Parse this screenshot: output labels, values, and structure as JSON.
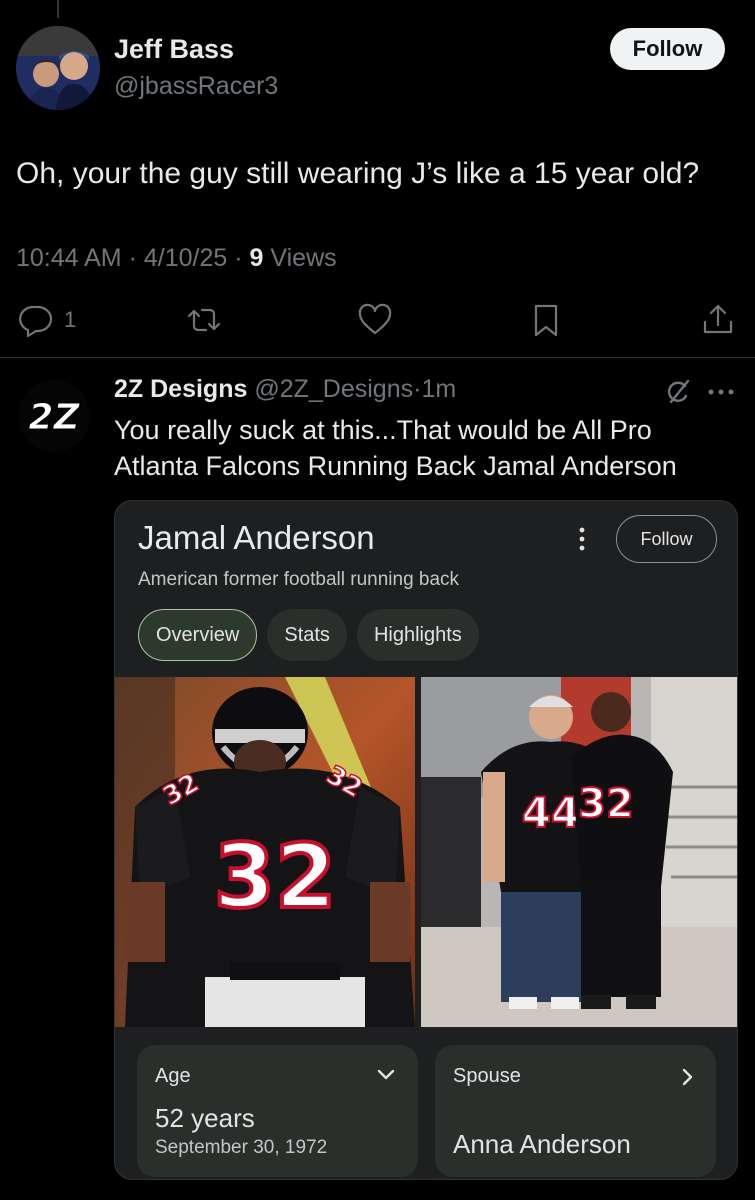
{
  "main_tweet": {
    "author_name": "Jeff Bass",
    "author_handle": "@jbassRacer3",
    "follow_label": "Follow",
    "text": "Oh, your the guy still wearing J’s like a 15 year old?",
    "time": "10:44 AM",
    "date": "4/10/25",
    "views_count": "9",
    "views_label": "Views",
    "reply_count": "1",
    "icons": [
      "reply-icon",
      "retweet-icon",
      "like-icon",
      "bookmark-icon",
      "share-icon"
    ]
  },
  "reply": {
    "author_name": "2Z Designs",
    "author_handle": "@2Z_Designs",
    "time": "1m",
    "avatar_text": "2Z",
    "text": "You really suck at this...That would be All Pro Atlanta Falcons Running Back Jamal Anderson"
  },
  "card": {
    "title": "Jamal Anderson",
    "subtitle": "American former football running back",
    "follow_label": "Follow",
    "tabs": [
      {
        "label": "Overview",
        "active": true
      },
      {
        "label": "Stats",
        "active": false
      },
      {
        "label": "Highlights",
        "active": false
      }
    ],
    "photo_left": {
      "jersey": "32"
    },
    "photo_right": {
      "jersey_a": "44",
      "jersey_b": "32"
    },
    "age": {
      "label": "Age",
      "value": "52 years",
      "date": "September 30, 1972"
    },
    "spouse": {
      "label": "Spouse",
      "value": "Anna Anderson"
    }
  },
  "colors": {
    "background": "#000000",
    "text_primary": "#e7e9ea",
    "text_secondary": "#71767b",
    "card_bg": "#1e1f20",
    "chip_bg": "#2a2f2b",
    "falcons_red": "#c8102e"
  }
}
